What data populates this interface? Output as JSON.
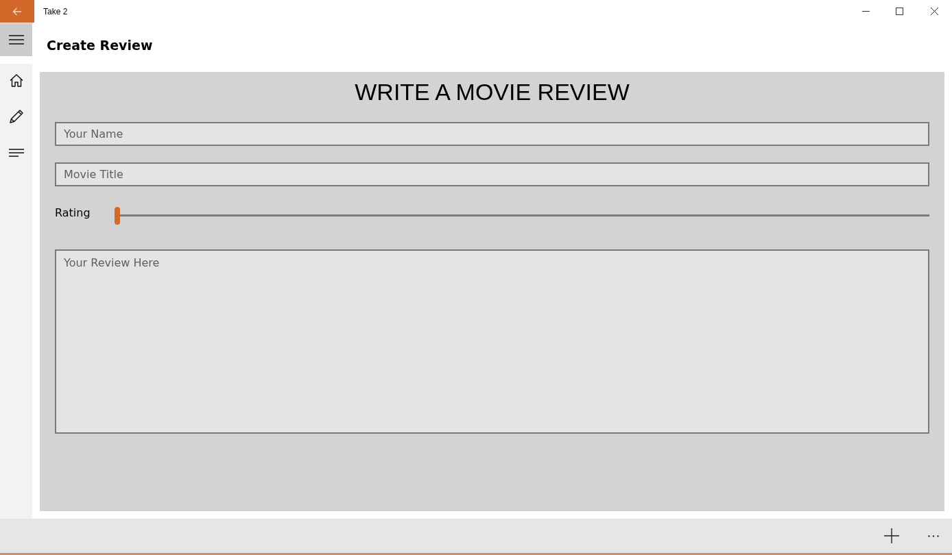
{
  "window": {
    "title": "Take 2"
  },
  "page_title": "Create Review",
  "form": {
    "heading": "WRITE A MOVIE REVIEW",
    "name_field": {
      "placeholder": "Your Name"
    },
    "title_field": {
      "placeholder": "Movie Title"
    },
    "rating": {
      "label": "Rating",
      "level": 0
    },
    "review_field": {
      "placeholder": "Your Review Here"
    }
  }
}
